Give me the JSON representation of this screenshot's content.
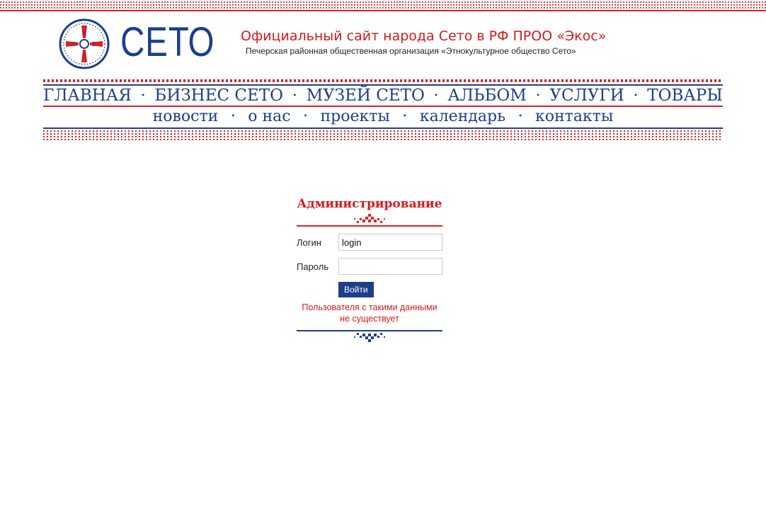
{
  "header": {
    "brand": "СЕТО",
    "site_title": "Официальный сайт народа Сето в РФ ПРОО «Экос»",
    "site_subtitle": "Печерская районная общественная организация «Этнокультурное общество Сето»",
    "logo_icon": "seto-emblem-icon"
  },
  "nav": {
    "main": [
      {
        "label": "ГЛАВНАЯ"
      },
      {
        "label": "БИЗНЕС СЕТО"
      },
      {
        "label": "МУЗЕЙ СЕТО"
      },
      {
        "label": "АЛЬБОМ"
      },
      {
        "label": "УСЛУГИ"
      },
      {
        "label": "ТОВАРЫ"
      }
    ],
    "sub": [
      {
        "label": "новости"
      },
      {
        "label": "о нас"
      },
      {
        "label": "проекты"
      },
      {
        "label": "календарь"
      },
      {
        "label": "контакты"
      }
    ],
    "separator": "•"
  },
  "admin": {
    "title": "Администрирование",
    "login_label": "Логин",
    "login_value": "login",
    "password_label": "Пароль",
    "password_value": "",
    "submit_label": "Войти",
    "error_message": "Пользователя с такими данными не существует"
  },
  "colors": {
    "accent_red": "#d51a1a",
    "brand_blue": "#1c3f8a"
  }
}
